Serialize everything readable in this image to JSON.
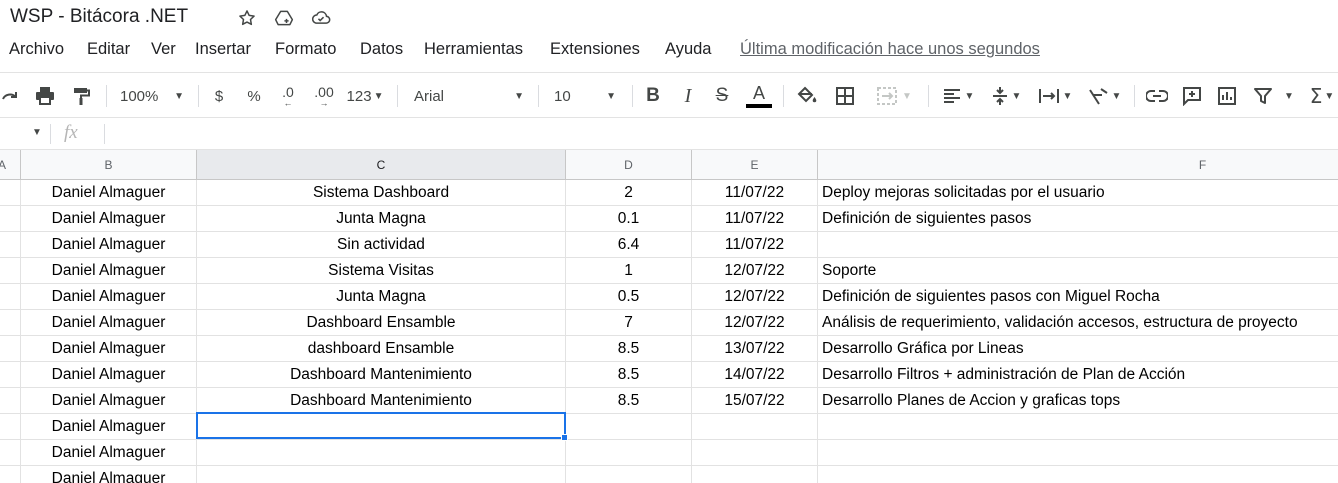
{
  "doc": {
    "title": "WSP - Bitácora .NET"
  },
  "menu": {
    "items": [
      "Archivo",
      "Editar",
      "Ver",
      "Insertar",
      "Formato",
      "Datos",
      "Herramientas",
      "Extensiones",
      "Ayuda"
    ],
    "last_edit": "Última modificación hace unos segundos"
  },
  "toolbar": {
    "zoom": "100%",
    "currency": "$",
    "percent": "%",
    "dec_decrease": ".0",
    "dec_increase": ".00",
    "format_more": "123",
    "font": "Arial",
    "font_size": "10",
    "bold": "B",
    "italic": "I",
    "strike": "S",
    "text_color": "A",
    "text_color_value": "#000000"
  },
  "formula_bar": {
    "fx": "fx",
    "value": ""
  },
  "columns": [
    "A",
    "B",
    "C",
    "D",
    "E",
    "F"
  ],
  "rows": [
    [
      "Daniel Almaguer",
      "Sistema Dashboard",
      "2",
      "11/07/22",
      "Deploy mejoras solicitadas por el usuario"
    ],
    [
      "Daniel Almaguer",
      "Junta Magna",
      "0.1",
      "11/07/22",
      "Definición de siguientes pasos"
    ],
    [
      "Daniel Almaguer",
      "Sin actividad",
      "6.4",
      "11/07/22",
      ""
    ],
    [
      "Daniel Almaguer",
      "Sistema Visitas",
      "1",
      "12/07/22",
      "Soporte"
    ],
    [
      "Daniel Almaguer",
      "Junta Magna",
      "0.5",
      "12/07/22",
      "Definición de siguientes pasos con Miguel Rocha"
    ],
    [
      "Daniel Almaguer",
      "Dashboard Ensamble",
      "7",
      "12/07/22",
      "Análisis de requerimiento, validación accesos,  estructura de proyecto"
    ],
    [
      "Daniel Almaguer",
      "dashboard Ensamble",
      "8.5",
      "13/07/22",
      "Desarrollo Gráfica por Lineas"
    ],
    [
      "Daniel Almaguer",
      "Dashboard Mantenimiento",
      "8.5",
      "14/07/22",
      "Desarrollo Filtros + administración de Plan de Acción"
    ],
    [
      "Daniel Almaguer",
      "Dashboard Mantenimiento",
      "8.5",
      "15/07/22",
      "Desarrollo Planes de Accion y graficas tops"
    ],
    [
      "Daniel Almaguer",
      "",
      "",
      "",
      ""
    ],
    [
      "Daniel Almaguer",
      "",
      "",
      "",
      ""
    ],
    [
      "Daniel Almaguer",
      "",
      "",
      "",
      ""
    ]
  ],
  "colors": {
    "selection": "#1a73e8",
    "header_bg": "#f8f9fa"
  }
}
